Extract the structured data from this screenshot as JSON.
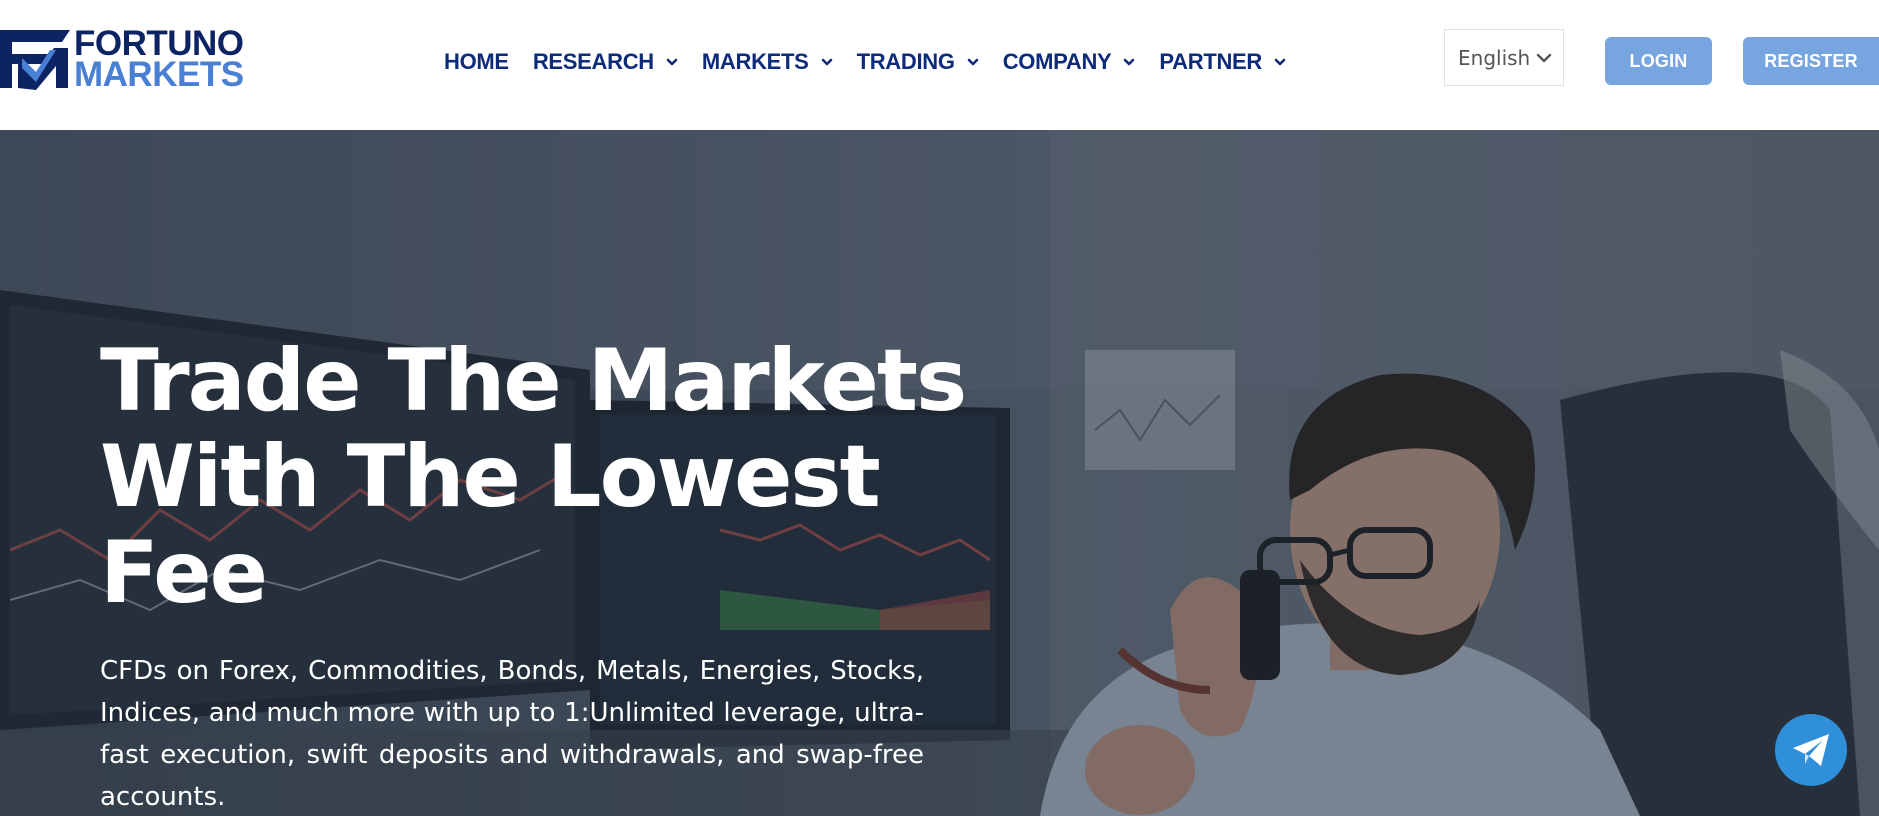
{
  "brand": {
    "line1": "FORTUNO",
    "line2": "MARKETS",
    "primary_color": "#0d2464",
    "accent_color": "#4a80d4"
  },
  "nav": {
    "items": [
      {
        "label": "HOME",
        "has_dropdown": false
      },
      {
        "label": "RESEARCH",
        "has_dropdown": true
      },
      {
        "label": "MARKETS",
        "has_dropdown": true
      },
      {
        "label": "TRADING",
        "has_dropdown": true
      },
      {
        "label": "COMPANY",
        "has_dropdown": true
      },
      {
        "label": "PARTNER",
        "has_dropdown": true
      }
    ],
    "color": "#0d2b7a"
  },
  "language": {
    "selected": "English",
    "icon": "chevron-down-icon"
  },
  "auth": {
    "login_label": "LOGIN",
    "register_label": "REGISTER",
    "button_color": "#77a5e0"
  },
  "hero": {
    "title": "Trade The Markets\nWith The Lowest\nFee",
    "description": "CFDs on Forex, Commodities, Bonds, Metals, Energies, Stocks, Indices, and much more with up to 1:Unlimited leverage, ultra-fast execution, swift deposits and withdrawals, and swap-free accounts."
  },
  "floating": {
    "telegram_icon": "telegram-icon",
    "color": "#2f8fd8"
  }
}
